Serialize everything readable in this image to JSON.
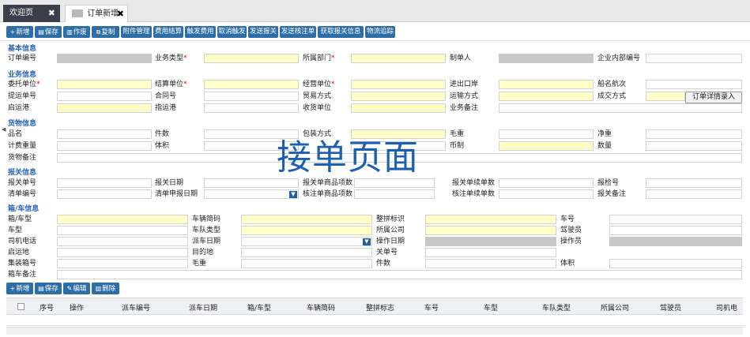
{
  "tabs": [
    {
      "label": "欢迎页",
      "close": "✖"
    },
    {
      "label": "订单新增",
      "close": "✖"
    }
  ],
  "toolbar": [
    {
      "icon": "+",
      "label": "新增"
    },
    {
      "icon": "▤",
      "label": "保存"
    },
    {
      "icon": "▥",
      "label": "作废"
    },
    {
      "icon": "⧉",
      "label": "复制"
    },
    {
      "icon": "",
      "label": "附件管理"
    },
    {
      "icon": "",
      "label": "费用结算"
    },
    {
      "icon": "",
      "label": "触发费用"
    },
    {
      "icon": "",
      "label": "取消触发"
    },
    {
      "icon": "",
      "label": "发送报关"
    },
    {
      "icon": "",
      "label": "发送核注单"
    },
    {
      "icon": "",
      "label": "获取报关信息"
    },
    {
      "icon": "",
      "label": "物流追踪"
    }
  ],
  "sections": [
    "基本信息",
    "业务信息",
    "货物信息",
    "报关信息",
    "箱/车信息"
  ],
  "basic": {
    "labels": [
      "订单编号",
      "业务类型",
      "所属部门",
      "制单人",
      "企业内部编号"
    ]
  },
  "business": {
    "labels": [
      "委托单位",
      "结算单位",
      "经营单位",
      "进出口岸",
      "船名航次",
      "提运单号",
      "合同号",
      "贸易方式",
      "运输方式",
      "成交方式",
      "启运港",
      "指运港",
      "收货单位",
      "业务备注"
    ]
  },
  "goods": {
    "labels": [
      "品名",
      "件数",
      "包装方式",
      "毛重",
      "净重",
      "计费重量",
      "体积",
      "",
      "币制",
      "数量",
      "货物备注"
    ]
  },
  "customs": {
    "labels": [
      "报关单号",
      "报关日期",
      "报关单商品项数",
      "报关单续单数",
      "报检号",
      "清单编号",
      "清单申报日期",
      "核注单商品项数",
      "核注单续单数",
      "报关备注"
    ]
  },
  "vehicle": {
    "labels": [
      "箱/车型",
      "车辆简码",
      "整拼标识",
      "车号",
      "车型",
      "车队类型",
      "所属公司",
      "驾驶员",
      "司机电话",
      "派车日期",
      "操作日期",
      "操作员",
      "启运地",
      "目的地",
      "关单号",
      "集装箱号",
      "毛重",
      "件数",
      "体积",
      "箱车备注"
    ]
  },
  "order_detail_button": "订单详情录入",
  "watermark": "接单页面",
  "toolbar2": [
    {
      "icon": "+",
      "label": "新增"
    },
    {
      "icon": "▤",
      "label": "保存"
    },
    {
      "icon": "✎",
      "label": "编辑"
    },
    {
      "icon": "▥",
      "label": "删除"
    }
  ],
  "grid": {
    "columns": [
      "序号",
      "操作",
      "派车编号",
      "派车日期",
      "箱/车型",
      "车辆简码",
      "整拼标志",
      "车号",
      "车型",
      "车队类型",
      "所属公司",
      "驾驶员",
      "司机电"
    ]
  },
  "icons": {
    "collapse": "collapse-arrow-icon",
    "dropdown": "chevron-down-icon"
  }
}
